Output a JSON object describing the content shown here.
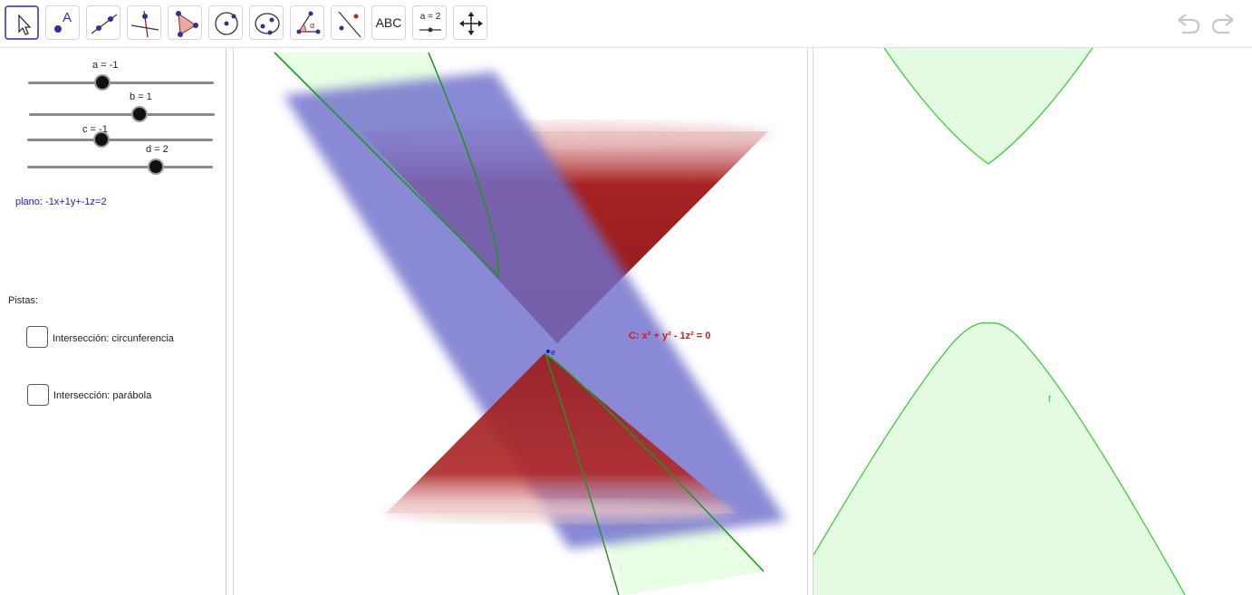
{
  "toolbar": {
    "tools": [
      {
        "name": "move-tool",
        "label": ""
      },
      {
        "name": "point-tool",
        "label": "A"
      },
      {
        "name": "line-tool",
        "label": ""
      },
      {
        "name": "perpendicular-tool",
        "label": ""
      },
      {
        "name": "polygon-tool",
        "label": ""
      },
      {
        "name": "circle-tool",
        "label": ""
      },
      {
        "name": "conic-tool",
        "label": ""
      },
      {
        "name": "angle-tool",
        "label": "α"
      },
      {
        "name": "reflect-tool",
        "label": ""
      },
      {
        "name": "text-tool",
        "label": "ABC"
      },
      {
        "name": "slider-tool",
        "label": "a = 2"
      },
      {
        "name": "move-view-tool",
        "label": ""
      }
    ]
  },
  "algebra": {
    "sliders": [
      {
        "label": "a = -1",
        "value": -1
      },
      {
        "label": "b = 1",
        "value": 1
      },
      {
        "label": "c = -1",
        "value": -1
      },
      {
        "label": "d = 2",
        "value": 2
      }
    ],
    "plane_text": "plano: -1x+1y+-1z=2",
    "hints_title": "Pistas:",
    "checkboxes": [
      {
        "label": "Intersección: circunferencia",
        "checked": false
      },
      {
        "label": "Intersección: parábola",
        "checked": false
      }
    ]
  },
  "view3d": {
    "cone_label": "C: x² + y² - 1z² = 0",
    "point_label": "e",
    "colors": {
      "cone": "#a31d1d",
      "plane": "#6f6fcc",
      "curve": "#1a9a1a",
      "fill": "#dfffd9"
    }
  },
  "view2d": {
    "curve_label": "f",
    "colors": {
      "curve": "#2ecc2e",
      "fill": "#e3fbe0"
    }
  }
}
